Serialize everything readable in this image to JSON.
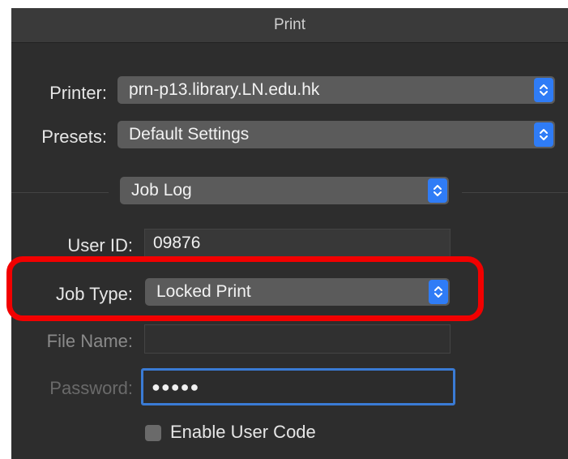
{
  "window": {
    "title": "Print"
  },
  "printer": {
    "label": "Printer:",
    "value": "prn-p13.library.LN.edu.hk"
  },
  "presets": {
    "label": "Presets:",
    "value": "Default Settings"
  },
  "section": {
    "value": "Job Log"
  },
  "user_id": {
    "label": "User ID:",
    "value": "09876"
  },
  "job_type": {
    "label": "Job Type:",
    "value": "Locked Print"
  },
  "file_name": {
    "label": "File Name:",
    "value": ""
  },
  "password": {
    "label": "Password:",
    "value": "●●●●●"
  },
  "user_code": {
    "label": "Enable User Code",
    "checked": false
  },
  "colors": {
    "accent": "#2f7cf6",
    "highlight": "#f20000",
    "panel": "#2d2d2d"
  },
  "icons": {
    "stepper": "chevron-up-down-icon"
  }
}
